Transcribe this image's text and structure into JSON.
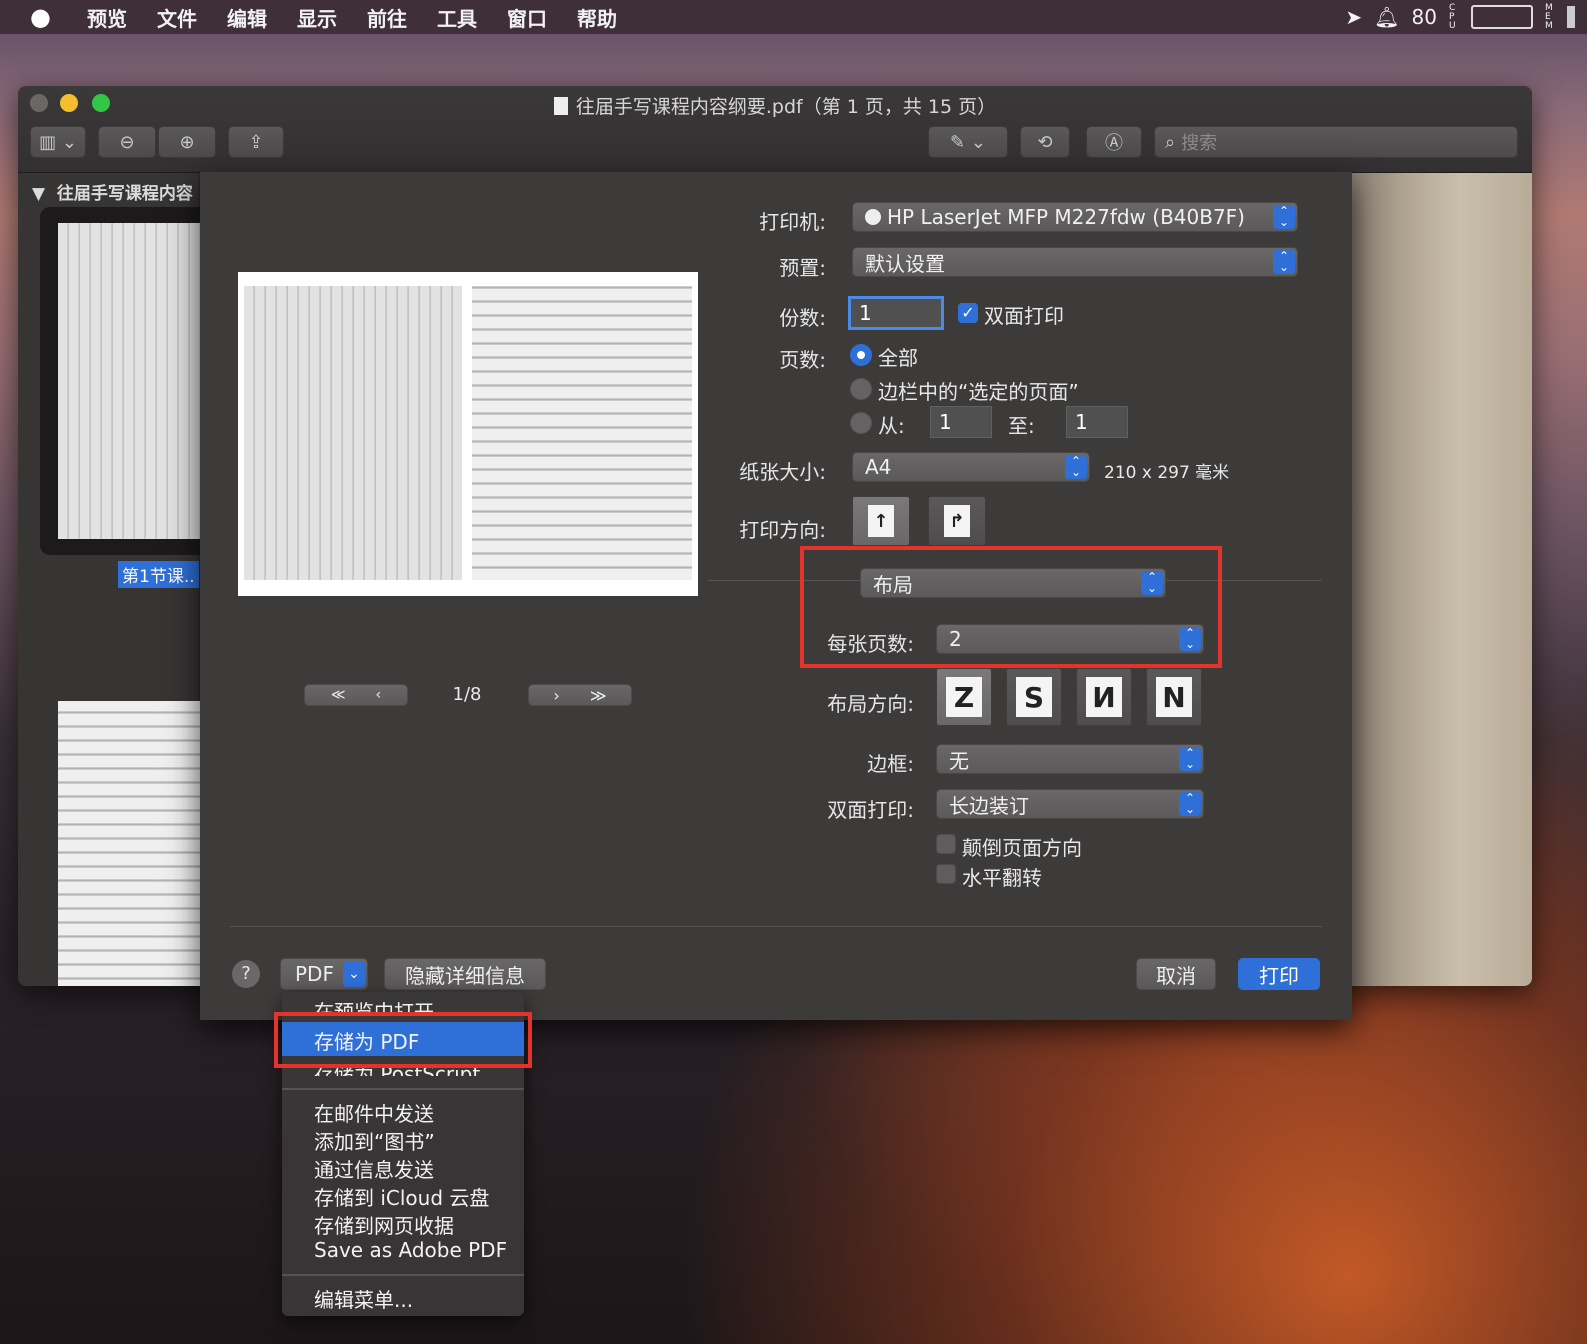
{
  "menubar": {
    "apple": "",
    "items": [
      "预览",
      "文件",
      "编辑",
      "显示",
      "前往",
      "工具",
      "窗口",
      "帮助"
    ],
    "battery": "80",
    "cpu": "CPU",
    "mem": "MEM"
  },
  "window": {
    "title": "往届手写课程内容纲要.pdf（第 1 页，共 15 页）",
    "search_placeholder": "搜索",
    "sidebar_title": "往届手写课程内容",
    "thumb_label": "第1节课.."
  },
  "print": {
    "printer_label": "打印机:",
    "printer_value": "HP LaserJet MFP M227fdw (B40B7F)",
    "preset_label": "预置:",
    "preset_value": "默认设置",
    "copies_label": "份数:",
    "copies_value": "1",
    "duplex_check_label": "双面打印",
    "pages_label": "页数:",
    "pages_all": "全部",
    "pages_selected": "边栏中的“选定的页面”",
    "pages_from_label": "从:",
    "pages_from_value": "1",
    "pages_to_label": "至:",
    "pages_to_value": "1",
    "paper_label": "纸张大小:",
    "paper_value": "A4",
    "paper_dims": "210 x 297 毫米",
    "orientation_label": "打印方向:",
    "section_value": "布局",
    "pages_per_sheet_label": "每张页数:",
    "pages_per_sheet_value": "2",
    "layout_dir_label": "布局方向:",
    "border_label": "边框:",
    "border_value": "无",
    "duplex_label": "双面打印:",
    "duplex_value": "长边装订",
    "reverse_label": "颠倒页面方向",
    "flip_label": "水平翻转",
    "page_indicator": "1/8",
    "help": "?",
    "pdf_button": "PDF",
    "hide_details": "隐藏详细信息",
    "cancel": "取消",
    "print_btn": "打印"
  },
  "pdf_menu": {
    "items": [
      "在预览中打开",
      "存储为 PDF",
      "存储为 PostScript",
      "在邮件中发送",
      "添加到“图书”",
      "通过信息发送",
      "存储到 iCloud 云盘",
      "存储到网页收据",
      "Save as Adobe PDF",
      "编辑菜单..."
    ],
    "highlighted_index": 1
  },
  "colors": {
    "accent": "#2f6fd8",
    "highlight_box": "#e3332a"
  }
}
